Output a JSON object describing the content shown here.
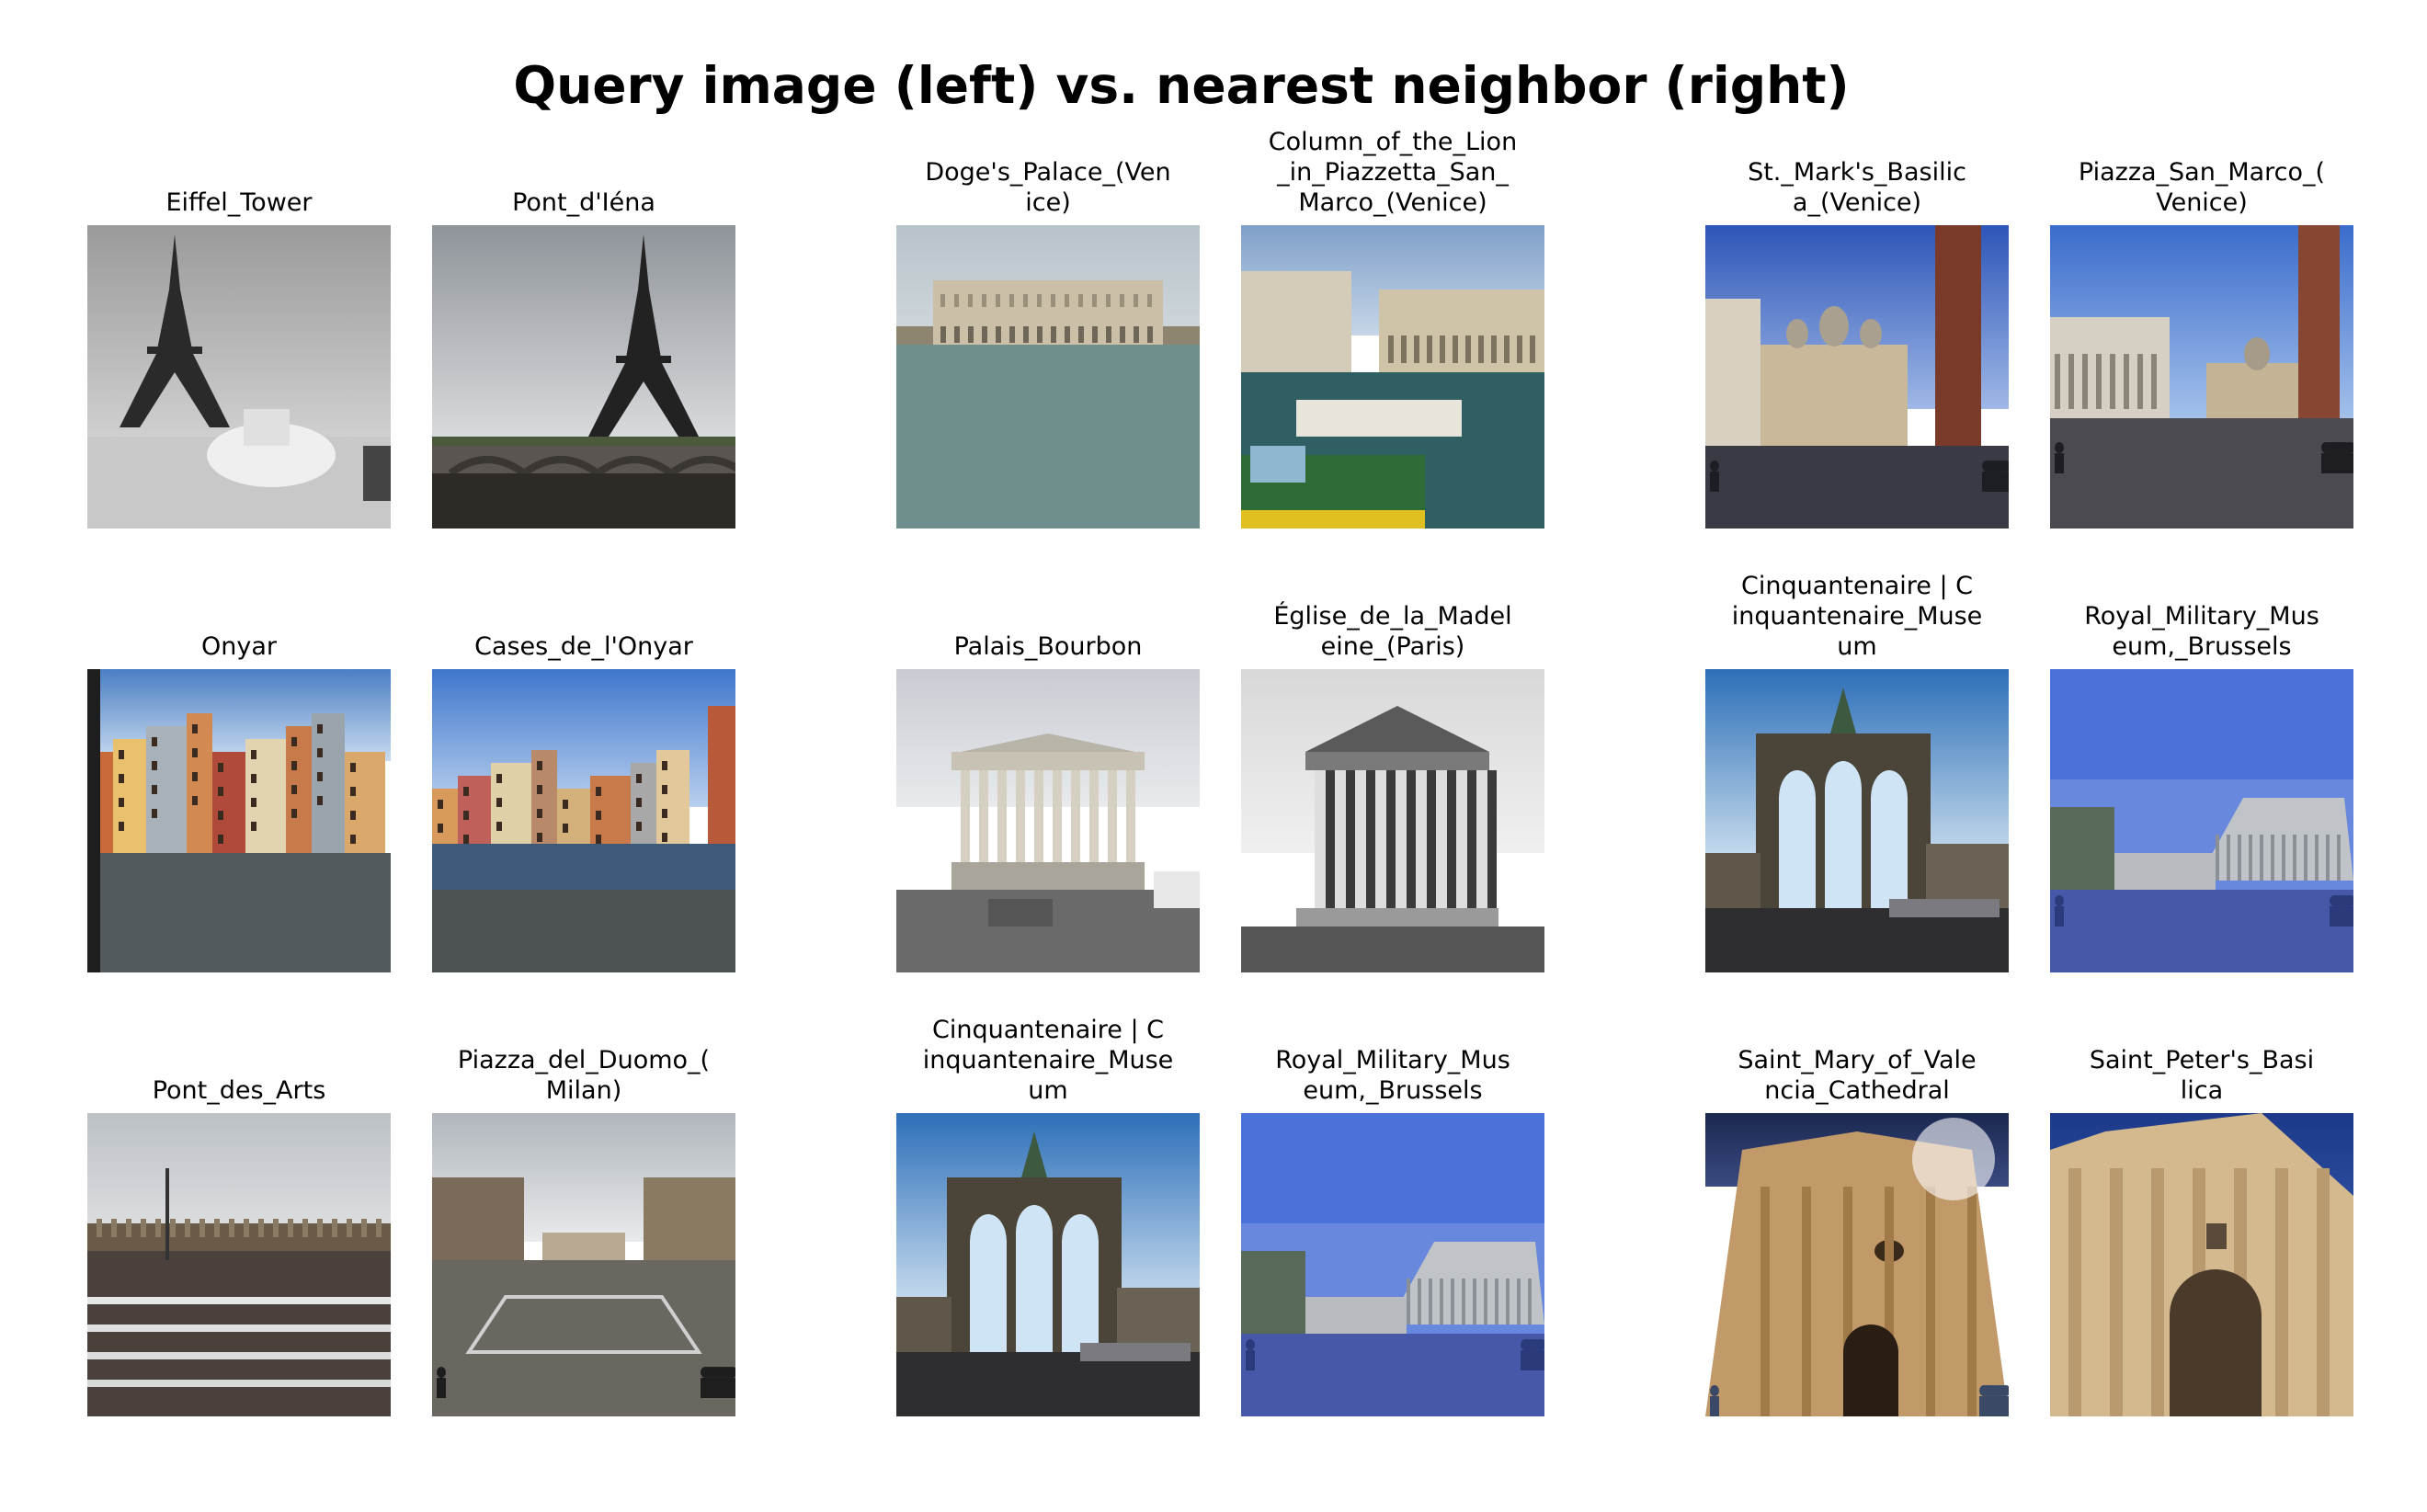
{
  "title": "Query image (left) vs. nearest neighbor (right)",
  "pairs": [
    {
      "query": {
        "label": "Eiffel_Tower",
        "scene": "eiffel-bw"
      },
      "neighbor": {
        "label": "Pont_d'Iéna",
        "scene": "eiffel-bridge"
      }
    },
    {
      "query": {
        "label": "Doge's_Palace_(Ven\nice)",
        "scene": "doges-palace"
      },
      "neighbor": {
        "label": "Column_of_the_Lion\n_in_Piazzetta_San_\nMarco_(Venice)",
        "scene": "piazzetta-boats"
      }
    },
    {
      "query": {
        "label": "St._Mark's_Basilic\na_(Venice)",
        "scene": "st-marks"
      },
      "neighbor": {
        "label": "Piazza_San_Marco_(\nVenice)",
        "scene": "piazza-san-marco"
      }
    },
    {
      "query": {
        "label": "Onyar",
        "scene": "onyar-houses"
      },
      "neighbor": {
        "label": "Cases_de_l'Onyar",
        "scene": "onyar-houses-2"
      }
    },
    {
      "query": {
        "label": "Palais_Bourbon",
        "scene": "palais-bourbon"
      },
      "neighbor": {
        "label": "Église_de_la_Madel\neine_(Paris)",
        "scene": "madeleine-bw"
      }
    },
    {
      "query": {
        "label": "Cinquantenaire | C\ninquantenaire_Muse\num",
        "scene": "cinquantenaire-arch"
      },
      "neighbor": {
        "label": "Royal_Military_Mus\neum,_Brussels",
        "scene": "military-museum"
      }
    },
    {
      "query": {
        "label": "Pont_des_Arts",
        "scene": "pont-des-arts"
      },
      "neighbor": {
        "label": "Piazza_del_Duomo_(\nMilan)",
        "scene": "duomo-milan"
      }
    },
    {
      "query": {
        "label": "Cinquantenaire | C\ninquantenaire_Muse\num",
        "scene": "cinquantenaire-arch"
      },
      "neighbor": {
        "label": "Royal_Military_Mus\neum,_Brussels",
        "scene": "military-museum"
      }
    },
    {
      "query": {
        "label": "Saint_Mary_of_Vale\nncia_Cathedral",
        "scene": "valencia-cathedral"
      },
      "neighbor": {
        "label": "Saint_Peter's_Basi\nlica",
        "scene": "st-peters"
      }
    }
  ]
}
